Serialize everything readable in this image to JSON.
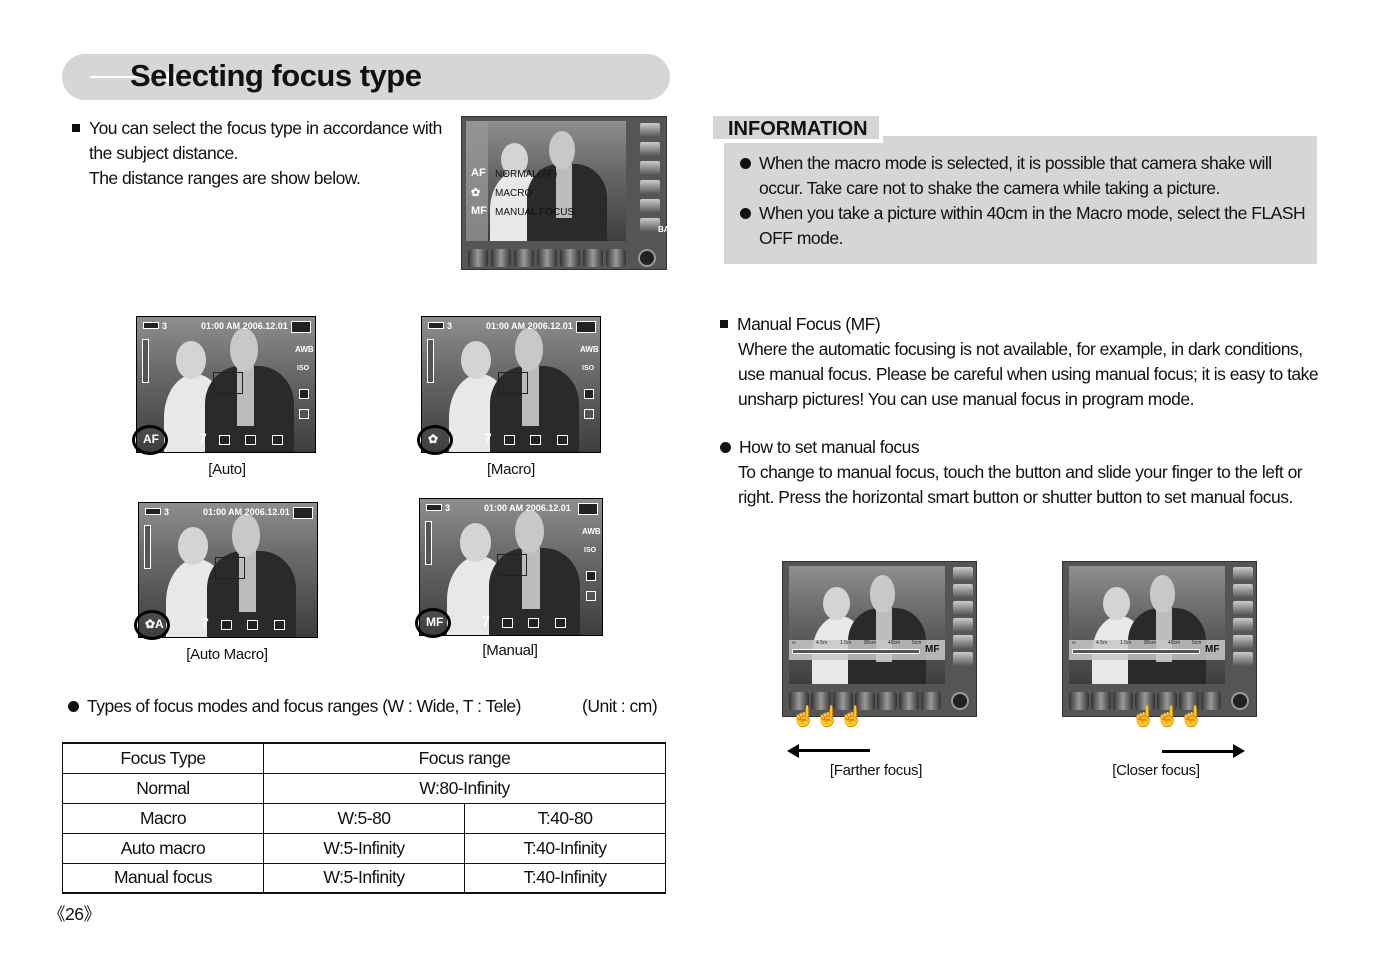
{
  "title": "Selecting focus type",
  "intro": [
    "You can select the focus type in accordance with",
    "the subject distance.",
    "The distance ranges are show below."
  ],
  "menu_screen": {
    "items": [
      {
        "icon": "AF",
        "label": "NORMAL(AF)"
      },
      {
        "icon": "✿",
        "label": "MACRO"
      },
      {
        "icon": "MF",
        "label": "MANUAL FOCUS"
      }
    ],
    "side_label": "BA"
  },
  "screens": [
    {
      "caption": "[Auto]",
      "mode": "AF",
      "datetime": "01:00 AM 2006.12.01",
      "shots": "3"
    },
    {
      "caption": "[Macro]",
      "mode": "✿",
      "datetime": "01:00 AM 2006.12.01",
      "shots": "3"
    },
    {
      "caption": "[Auto Macro]",
      "mode": "✿A",
      "datetime": "01:00 AM 2006.12.01",
      "shots": "3"
    },
    {
      "caption": "[Manual]",
      "mode": "MF",
      "datetime": "01:00 AM 2006.12.01",
      "shots": "3"
    }
  ],
  "screen_labels": {
    "awb": "AWB",
    "iso": "ISO"
  },
  "types_line": "Types of focus modes and focus ranges (W : Wide, T : Tele)",
  "unit": "(Unit : cm)",
  "table": {
    "headers": [
      "Focus Type",
      "Focus range"
    ],
    "rows": [
      [
        "Normal",
        "W:80-Infinity"
      ],
      [
        "Macro",
        "W:5-80",
        "T:40-80"
      ],
      [
        "Auto macro",
        "W:5-Infinity",
        "T:40-Infinity"
      ],
      [
        "Manual focus",
        "W:5-Infinity",
        "T:40-Infinity"
      ]
    ]
  },
  "page_number": "《26》",
  "info": {
    "label": "INFORMATION",
    "bullets": [
      [
        "When the macro mode is selected, it is possible that camera shake will",
        "occur. Take care not to shake the camera while taking a picture."
      ],
      [
        "When you take a picture within 40cm in the Macro mode, select the FLASH",
        "OFF mode."
      ]
    ]
  },
  "mf": {
    "heading": "Manual Focus (MF)",
    "lines": [
      "Where the automatic focusing is not available, for example, in dark conditions,",
      "use manual focus. Please be careful when using manual focus; it is easy to take",
      "unsharp pictures! You can use manual focus in program mode."
    ]
  },
  "howto": {
    "heading": "How to set manual focus",
    "lines": [
      "To change to manual focus, touch the button and slide your finger to the left or",
      "right. Press the horizontal smart button or shutter button to set manual focus."
    ]
  },
  "mf_scale": {
    "ticks": [
      "∞",
      "4.5m",
      "1.5m",
      "80cm",
      "40cm",
      "5cm"
    ],
    "label": "MF"
  },
  "mf_screens": [
    {
      "caption": "[Farther focus]",
      "direction": "left"
    },
    {
      "caption": "[Closer focus]",
      "direction": "right"
    }
  ]
}
